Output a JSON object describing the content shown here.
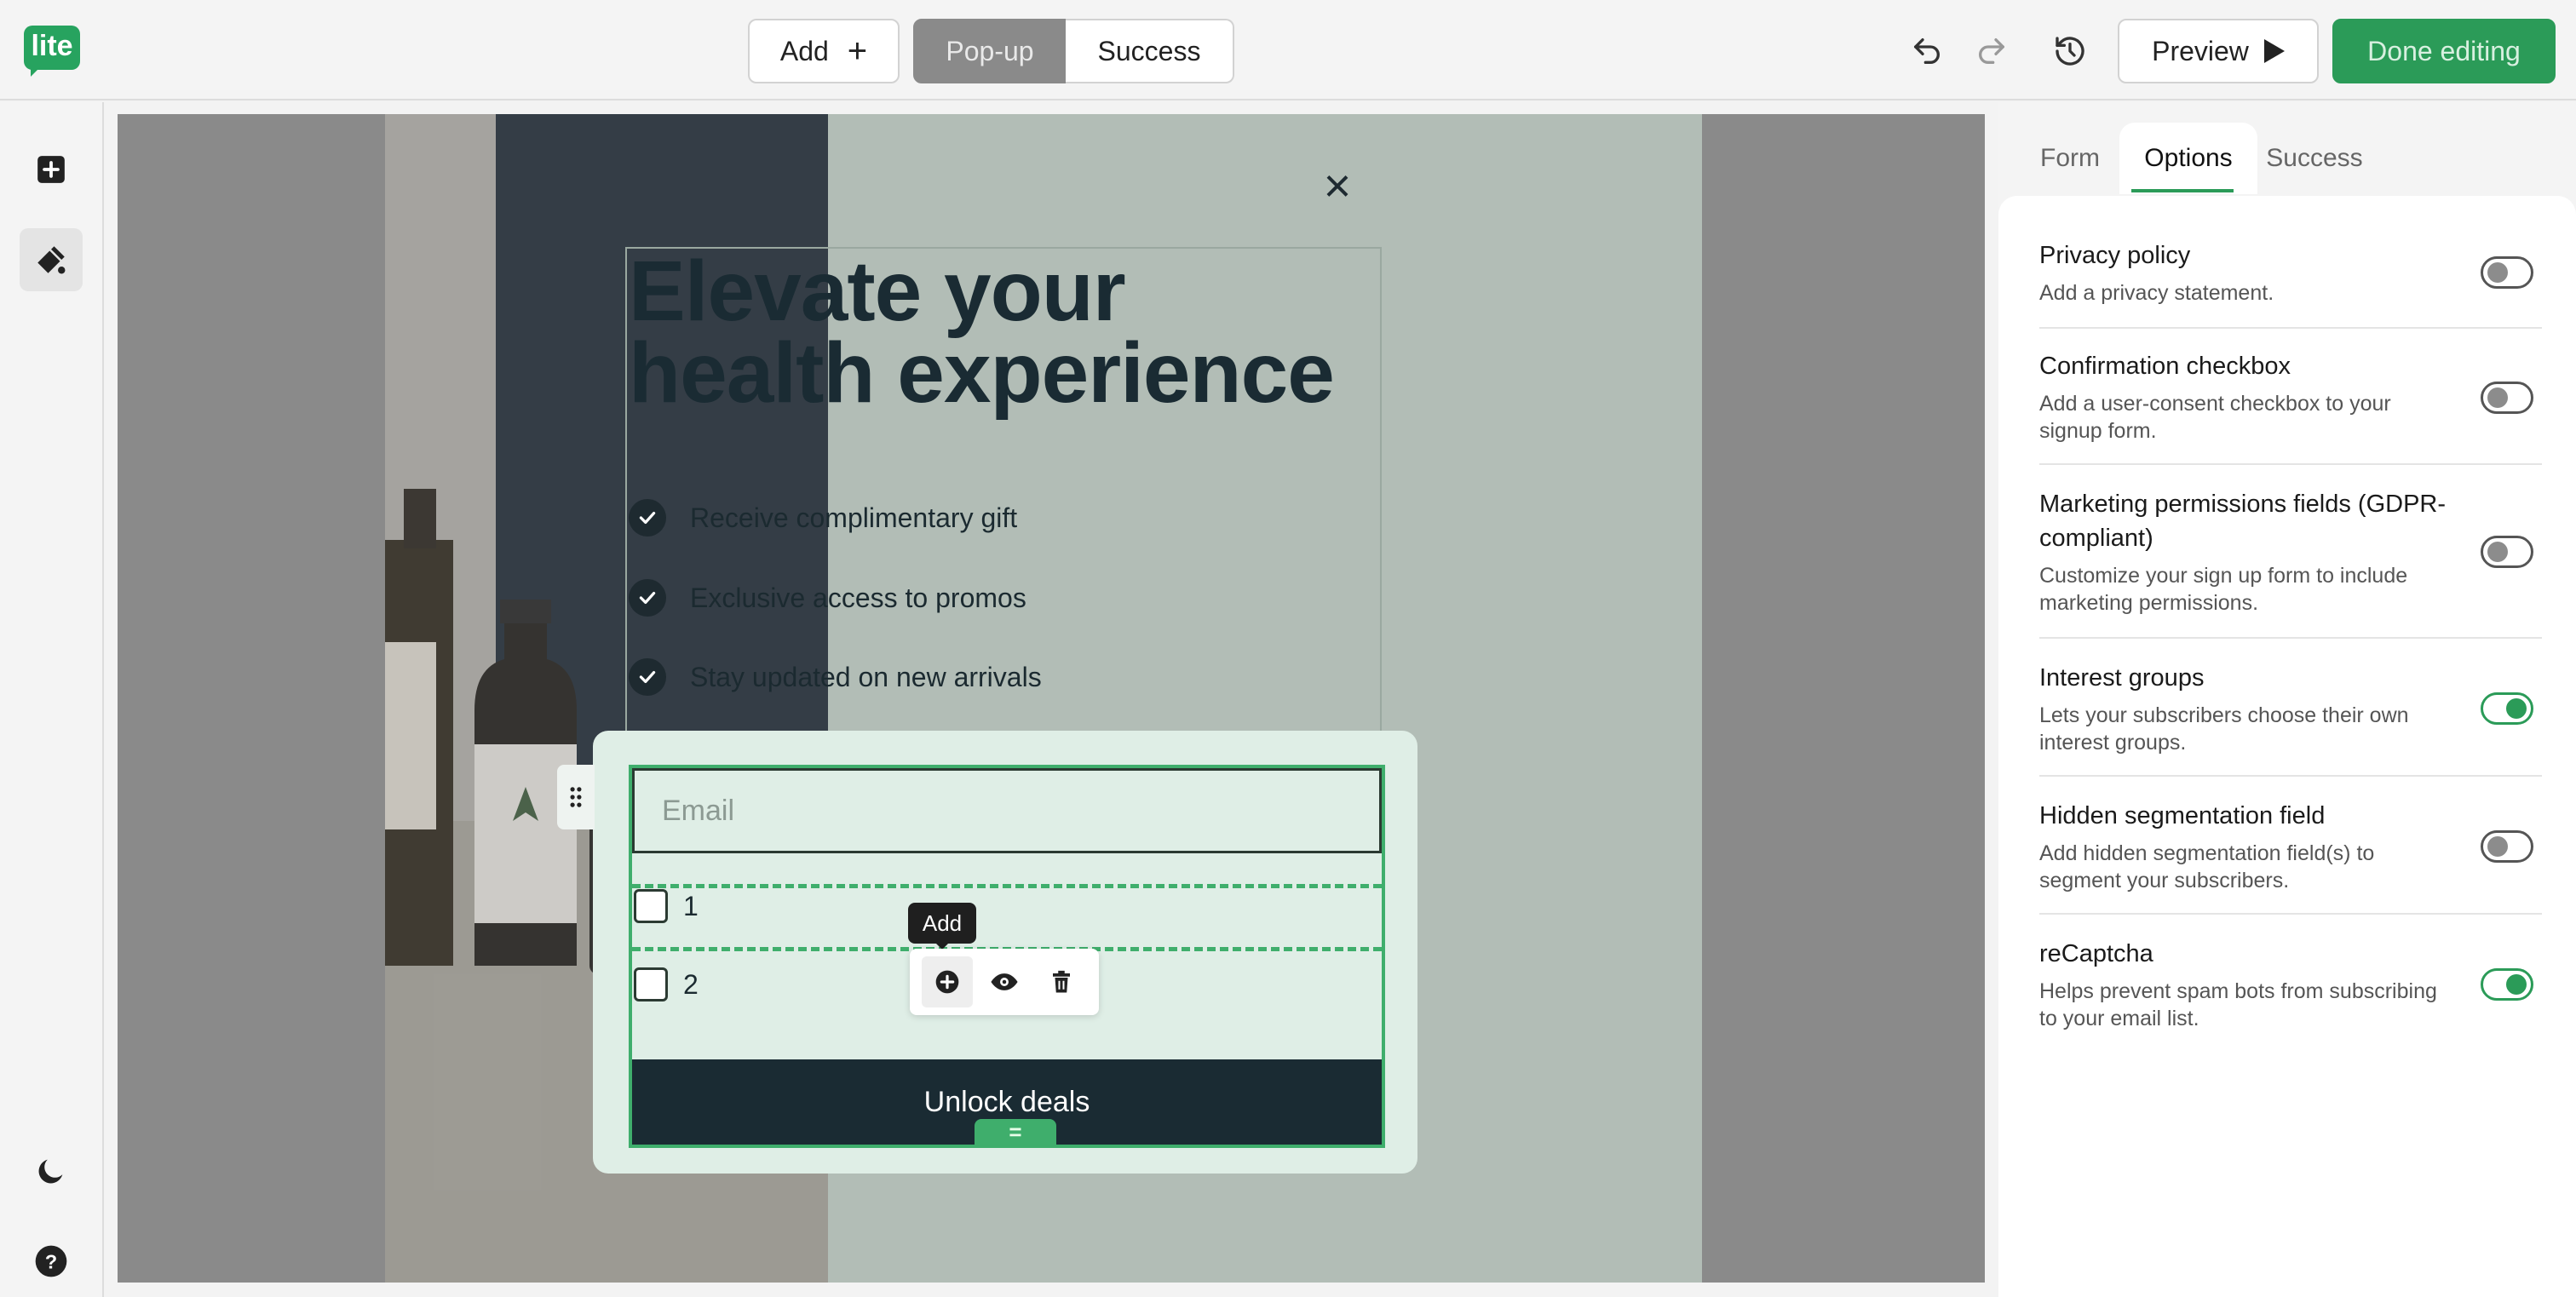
{
  "app": {
    "logo_text": "lite"
  },
  "toolbar": {
    "add_label": "Add",
    "add_icon": "plus-icon",
    "segments": [
      {
        "label": "Pop-up",
        "active": true
      },
      {
        "label": "Success",
        "active": false
      }
    ],
    "undo_icon": "undo-icon",
    "redo_icon": "redo-icon",
    "history_icon": "history-icon",
    "preview_label": "Preview",
    "preview_icon": "play-icon",
    "done_label": "Done editing"
  },
  "left_rail": {
    "items": [
      {
        "icon": "add-block-icon"
      },
      {
        "icon": "design-brush-icon"
      },
      {
        "icon": "dark-mode-moon-icon"
      },
      {
        "icon": "help-icon"
      }
    ]
  },
  "popup": {
    "close_glyph": "×",
    "heading_lines": [
      "Elevate your",
      "health experience"
    ],
    "benefits": [
      "Receive complimentary gift",
      "Exclusive access to promos",
      "Stay updated on new arrivals"
    ],
    "email_placeholder": "Email",
    "interest_groups": [
      "1",
      "2"
    ],
    "tooltip": "Add",
    "action_icons": [
      "add-circle-icon",
      "eye-icon",
      "trash-icon"
    ],
    "submit_label": "Unlock deals",
    "resize_glyph": "="
  },
  "right_panel": {
    "tabs": [
      {
        "label": "Form",
        "active": false
      },
      {
        "label": "Options",
        "active": true
      },
      {
        "label": "Success",
        "active": false
      }
    ],
    "options": [
      {
        "title": "Privacy policy",
        "desc": "Add a privacy statement.",
        "enabled": false
      },
      {
        "title": "Confirmation checkbox",
        "desc": "Add a user-consent checkbox to your signup form.",
        "enabled": false
      },
      {
        "title": "Marketing permissions fields (GDPR-compliant)",
        "desc": "Customize your sign up form to include marketing permissions.",
        "enabled": false
      },
      {
        "title": "Interest groups",
        "desc": "Lets your subscribers choose their own interest groups.",
        "enabled": true
      },
      {
        "title": "Hidden segmentation field",
        "desc": "Add hidden segmentation field(s) to segment your subscribers.",
        "enabled": false
      },
      {
        "title": "reCaptcha",
        "desc": "Helps prevent spam bots from subscribing to your email list.",
        "enabled": true
      }
    ]
  },
  "colors": {
    "brand_green": "#2b9b58",
    "popup_dark": "#1a2b33",
    "form_card_bg": "#dfeee6",
    "selection_green": "#3fae6c"
  }
}
